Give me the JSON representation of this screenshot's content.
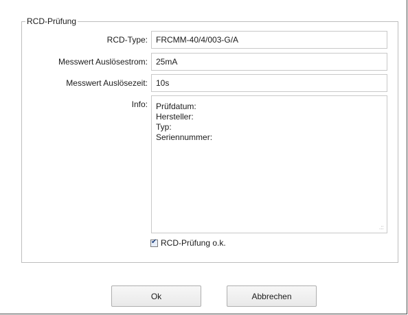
{
  "group": {
    "title": "RCD-Prüfung"
  },
  "form": {
    "rcd_type": {
      "label": "RCD-Type:",
      "value": "FRCMM-40/4/003-G/A"
    },
    "ausloesestrom": {
      "label": "Messwert Auslösestrom:",
      "value": "25mA"
    },
    "ausloesezeit": {
      "label": "Messwert Auslösezeit:",
      "value": "10s"
    },
    "info": {
      "label": "Info:",
      "lines": [
        "Prüfdatum:",
        "Hersteller:",
        "Typ:",
        "Seriennummer:"
      ]
    },
    "check": {
      "label": "RCD-Prüfung o.k.",
      "checked": true
    }
  },
  "buttons": {
    "ok": "Ok",
    "cancel": "Abbrechen"
  }
}
